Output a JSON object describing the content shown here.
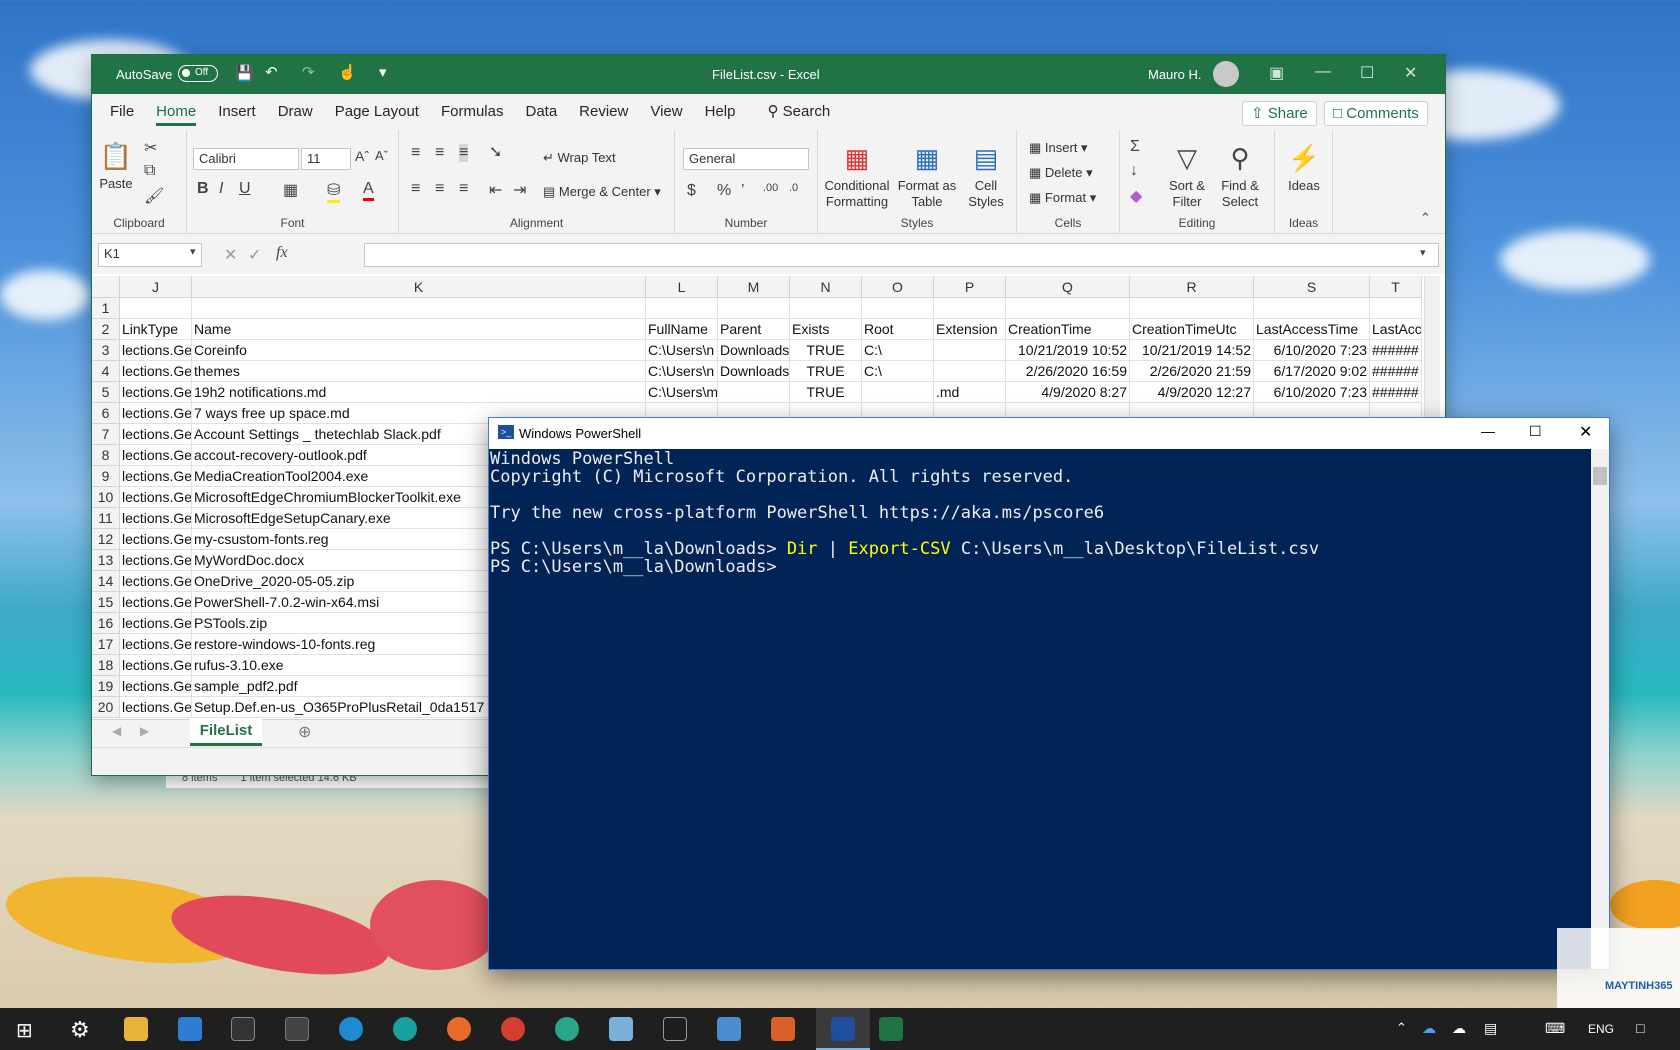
{
  "excel": {
    "autosave_label": "AutoSave",
    "autosave_state": "Off",
    "title": "FileList.csv  -  Excel",
    "user": "Mauro H.",
    "menu": [
      "File",
      "Home",
      "Insert",
      "Draw",
      "Page Layout",
      "Formulas",
      "Data",
      "Review",
      "View",
      "Help"
    ],
    "search": "Search",
    "share": "Share",
    "comments": "Comments",
    "ribbon": {
      "paste": "Paste",
      "clipboard": "Clipboard",
      "font_name": "Calibri",
      "font_size": "11",
      "font": "Font",
      "wrap_text": "Wrap Text",
      "merge_center": "Merge & Center",
      "alignment": "Alignment",
      "number_format": "General",
      "number": "Number",
      "cond_fmt": [
        "Conditional",
        "Formatting"
      ],
      "fmt_table": [
        "Format as",
        "Table"
      ],
      "cell_styles": [
        "Cell",
        "Styles"
      ],
      "styles": "Styles",
      "insert": "Insert",
      "delete": "Delete",
      "format": "Format",
      "cells": "Cells",
      "sort_filter": [
        "Sort &",
        "Filter"
      ],
      "find_select": [
        "Find &",
        "Select"
      ],
      "editing": "Editing",
      "ideas": "Ideas",
      "ideas_group": "Ideas"
    },
    "name_box": "K1",
    "columns": [
      "J",
      "K",
      "L",
      "M",
      "N",
      "O",
      "P",
      "Q",
      "R",
      "S",
      "T"
    ],
    "rows": [
      {
        "n": "1",
        "cells": [
          "",
          "",
          "",
          "",
          "",
          "",
          "",
          "",
          "",
          "",
          ""
        ]
      },
      {
        "n": "2",
        "cells": [
          "LinkType",
          "Name",
          "FullName",
          "Parent",
          "Exists",
          "Root",
          "Extension",
          "CreationTime",
          "CreationTimeUtc",
          "LastAccessTime",
          "LastAcc"
        ]
      },
      {
        "n": "3",
        "cells": [
          "lections.Ge",
          "Coreinfo",
          "C:\\Users\\n",
          "Downloads",
          "TRUE",
          "C:\\",
          "",
          "10/21/2019 10:52",
          "10/21/2019 14:52",
          "6/10/2020 7:23",
          "######"
        ]
      },
      {
        "n": "4",
        "cells": [
          "lections.Ge",
          "themes",
          "C:\\Users\\n",
          "Downloads",
          "TRUE",
          "C:\\",
          "",
          "2/26/2020 16:59",
          "2/26/2020 21:59",
          "6/17/2020 9:02",
          "######"
        ]
      },
      {
        "n": "5",
        "cells": [
          "lections.Ge",
          "19h2 notifications.md",
          "C:\\Users\\m__la\\Downl",
          "",
          "TRUE",
          "",
          ".md",
          "4/9/2020 8:27",
          "4/9/2020 12:27",
          "6/10/2020 7:23",
          "######"
        ]
      },
      {
        "n": "6",
        "cells": [
          "lections.Ge",
          "7 ways free up space.md",
          "",
          "",
          "",
          "",
          "",
          "",
          "",
          "",
          ""
        ]
      },
      {
        "n": "7",
        "cells": [
          "lections.Ge",
          "Account Settings _ thetechlab Slack.pdf",
          "",
          "",
          "",
          "",
          "",
          "",
          "",
          "",
          ""
        ]
      },
      {
        "n": "8",
        "cells": [
          "lections.Ge",
          "accout-recovery-outlook.pdf",
          "",
          "",
          "",
          "",
          "",
          "",
          "",
          "",
          ""
        ]
      },
      {
        "n": "9",
        "cells": [
          "lections.Ge",
          "MediaCreationTool2004.exe",
          "",
          "",
          "",
          "",
          "",
          "",
          "",
          "",
          ""
        ]
      },
      {
        "n": "10",
        "cells": [
          "lections.Ge",
          "MicrosoftEdgeChromiumBlockerToolkit.exe",
          "",
          "",
          "",
          "",
          "",
          "",
          "",
          "",
          ""
        ]
      },
      {
        "n": "11",
        "cells": [
          "lections.Ge",
          "MicrosoftEdgeSetupCanary.exe",
          "",
          "",
          "",
          "",
          "",
          "",
          "",
          "",
          ""
        ]
      },
      {
        "n": "12",
        "cells": [
          "lections.Ge",
          "my-csustom-fonts.reg",
          "",
          "",
          "",
          "",
          "",
          "",
          "",
          "",
          ""
        ]
      },
      {
        "n": "13",
        "cells": [
          "lections.Ge",
          "MyWordDoc.docx",
          "",
          "",
          "",
          "",
          "",
          "",
          "",
          "",
          ""
        ]
      },
      {
        "n": "14",
        "cells": [
          "lections.Ge",
          "OneDrive_2020-05-05.zip",
          "",
          "",
          "",
          "",
          "",
          "",
          "",
          "",
          ""
        ]
      },
      {
        "n": "15",
        "cells": [
          "lections.Ge",
          "PowerShell-7.0.2-win-x64.msi",
          "",
          "",
          "",
          "",
          "",
          "",
          "",
          "",
          ""
        ]
      },
      {
        "n": "16",
        "cells": [
          "lections.Ge",
          "PSTools.zip",
          "",
          "",
          "",
          "",
          "",
          "",
          "",
          "",
          ""
        ]
      },
      {
        "n": "17",
        "cells": [
          "lections.Ge",
          "restore-windows-10-fonts.reg",
          "",
          "",
          "",
          "",
          "",
          "",
          "",
          "",
          ""
        ]
      },
      {
        "n": "18",
        "cells": [
          "lections.Ge",
          "rufus-3.10.exe",
          "",
          "",
          "",
          "",
          "",
          "",
          "",
          "",
          ""
        ]
      },
      {
        "n": "19",
        "cells": [
          "lections.Ge",
          "sample_pdf2.pdf",
          "",
          "",
          "",
          "",
          "",
          "",
          "",
          "",
          ""
        ]
      },
      {
        "n": "20",
        "cells": [
          "lections.Ge",
          "Setup.Def.en-us_O365ProPlusRetail_0da1517",
          "",
          "",
          "",
          "",
          "",
          "",
          "",
          "",
          ""
        ]
      }
    ],
    "sheet_tab": "FileList"
  },
  "explorer": {
    "items": "8 items",
    "selected": "1 item selected  14.6 KB"
  },
  "powershell": {
    "title": "Windows PowerShell",
    "line1": "Windows PowerShell",
    "line2": "Copyright (C) Microsoft Corporation. All rights reserved.",
    "line3": "Try the new cross-platform PowerShell https://aka.ms/pscore6",
    "prompt": "PS C:\\Users\\m__la\\Downloads> ",
    "cmd1": "Dir",
    "pipe": " | ",
    "cmd2": "Export-CSV",
    "arg": " C:\\Users\\m__la\\Desktop\\FileList.csv",
    "prompt2": "PS C:\\Users\\m__la\\Downloads>"
  },
  "taskbar": {
    "lang": "ENG"
  },
  "watermark": "MAYTINH365"
}
